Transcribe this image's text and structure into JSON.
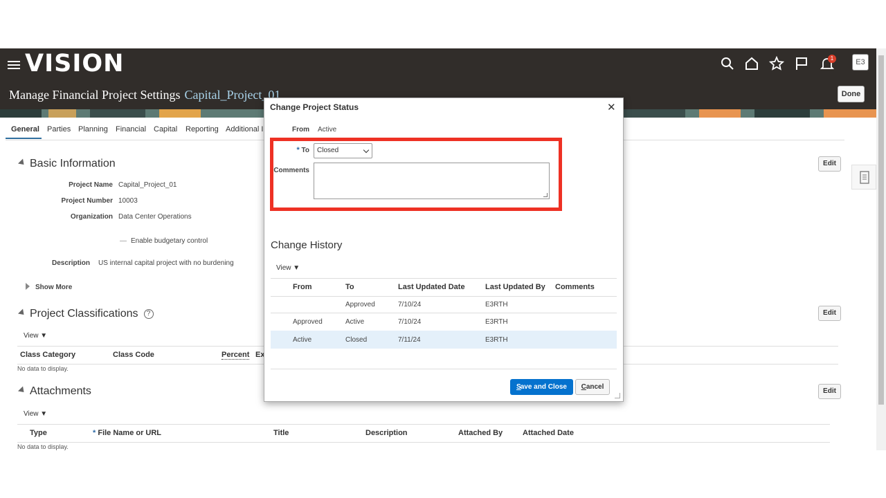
{
  "header": {
    "logo": "vision",
    "page_title": "Manage Financial Project Settings",
    "project_link": "Capital_Project_01",
    "notification_count": "1",
    "user_initials": "E3",
    "done_label": "Done"
  },
  "tabs": [
    "General",
    "Parties",
    "Planning",
    "Financial",
    "Capital",
    "Reporting",
    "Additional In"
  ],
  "basic_info": {
    "title": "Basic Information",
    "project_name_label": "Project Name",
    "project_name": "Capital_Project_01",
    "project_number_label": "Project Number",
    "project_number": "10003",
    "organization_label": "Organization",
    "organization": "Data Center Operations",
    "budgetary_control": "Enable budgetary control",
    "description_label": "Description",
    "description": "US internal capital project with no burdening",
    "show_more": "Show More",
    "edit": "Edit"
  },
  "classifications": {
    "title": "Project Classifications",
    "view": "View",
    "columns": [
      "Class Category",
      "Class Code",
      "Percent",
      "Ex"
    ],
    "no_data": "No data to display.",
    "edit": "Edit"
  },
  "attachments": {
    "title": "Attachments",
    "view": "View",
    "columns": [
      "Type",
      "File Name or URL",
      "Title",
      "Description",
      "Attached By",
      "Attached Date"
    ],
    "no_data": "No data to display.",
    "edit": "Edit"
  },
  "dialog": {
    "title": "Change Project Status",
    "from_label": "From",
    "from_value": "Active",
    "to_label": "To",
    "to_value": "Closed",
    "comments_label": "Comments",
    "history_title": "Change History",
    "view": "View",
    "history_columns": [
      "From",
      "To",
      "Last Updated Date",
      "Last Updated By",
      "Comments"
    ],
    "history_rows": [
      {
        "from": "",
        "to": "Approved",
        "date": "7/10/24",
        "by": "E3RTH",
        "comments": ""
      },
      {
        "from": "Approved",
        "to": "Active",
        "date": "7/10/24",
        "by": "E3RTH",
        "comments": ""
      },
      {
        "from": "Active",
        "to": "Closed",
        "date": "7/11/24",
        "by": "E3RTH",
        "comments": ""
      }
    ],
    "save_close": "Save and Close",
    "cancel": "Cancel"
  },
  "colors": {
    "header_bg": "#312d2a",
    "highlight": "#ee3124",
    "primary_button": "#0572ce",
    "link": "#a9d3ea"
  }
}
